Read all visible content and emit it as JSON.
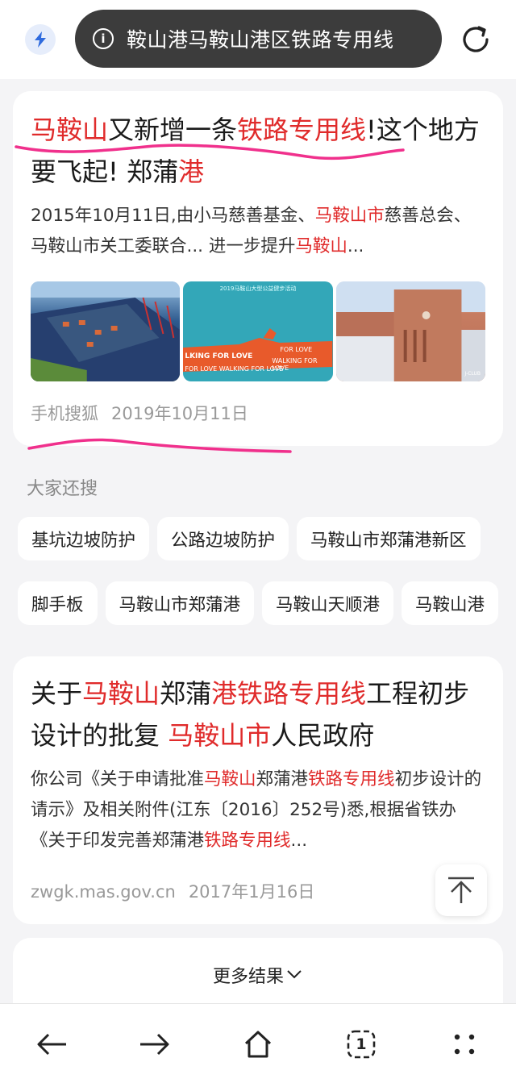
{
  "address_bar": {
    "text": "鞍山港马鞍山港区铁路专用线"
  },
  "result1": {
    "title_parts": [
      {
        "text": "马鞍山",
        "hl": true
      },
      {
        "text": "又新增一条",
        "hl": false
      },
      {
        "text": "铁路专用线",
        "hl": true
      },
      {
        "text": "!这个地方要飞起! 郑蒲",
        "hl": false
      },
      {
        "text": "港",
        "hl": true
      }
    ],
    "snippet_parts": [
      {
        "text": "2015年10月11日,由小马慈善基金、",
        "hl": false
      },
      {
        "text": "马鞍山市",
        "hl": true
      },
      {
        "text": "慈善总会、马鞍山市关工委联合... 进一步提升",
        "hl": false
      },
      {
        "text": "马鞍山",
        "hl": true
      },
      {
        "text": "...",
        "hl": false
      }
    ],
    "thumb2_text": [
      "2019马鞍山大型公益健步活动",
      "FOR LOVE",
      "WALKING FOR LOVE",
      "LKING FOR LOVE",
      "FOR LOVE WALKING FOR LOVE"
    ],
    "thumb3_text": "J-CLUB",
    "source": "手机搜狐",
    "date": "2019年10月11日"
  },
  "related": {
    "label": "大家还搜",
    "row1": [
      "基坑边坡防护",
      "公路边坡防护",
      "马鞍山市郑蒲港新区"
    ],
    "row2": [
      "脚手板",
      "马鞍山市郑蒲港",
      "马鞍山天顺港",
      "马鞍山港"
    ]
  },
  "result2": {
    "title_parts": [
      {
        "text": "关于",
        "hl": false
      },
      {
        "text": "马鞍山",
        "hl": true
      },
      {
        "text": "郑蒲",
        "hl": false
      },
      {
        "text": "港铁路专用线",
        "hl": true
      },
      {
        "text": "工程初步设计的批复 ",
        "hl": false
      },
      {
        "text": "马鞍山市",
        "hl": true
      },
      {
        "text": "人民政府",
        "hl": false
      }
    ],
    "snippet_parts": [
      {
        "text": "你公司《关于申请批准",
        "hl": false
      },
      {
        "text": "马鞍山",
        "hl": true
      },
      {
        "text": "郑蒲港",
        "hl": false
      },
      {
        "text": "铁路专用线",
        "hl": true
      },
      {
        "text": "初步设计的请示》及相关附件(江东〔2016〕252号)悉,根据省铁办《关于印发完善郑蒲港",
        "hl": false
      },
      {
        "text": "铁路专用线",
        "hl": true
      },
      {
        "text": "...",
        "hl": false
      }
    ],
    "source": "zwgk.mas.gov.cn",
    "date": "2017年1月16日"
  },
  "more_results": {
    "label": "更多结果"
  },
  "bottom_nav": {
    "tab_count": "1"
  },
  "colors": {
    "highlight": "#e02b2b",
    "underline_pen": "#f0308c",
    "addr_bg": "#3c3c3c"
  },
  "icons": [
    "bolt-icon",
    "info-icon",
    "reload-icon",
    "chevron-down-icon",
    "arrow-up-icon",
    "back-arrow-icon",
    "forward-arrow-icon",
    "home-icon",
    "tabs-icon",
    "more-dots-icon"
  ]
}
